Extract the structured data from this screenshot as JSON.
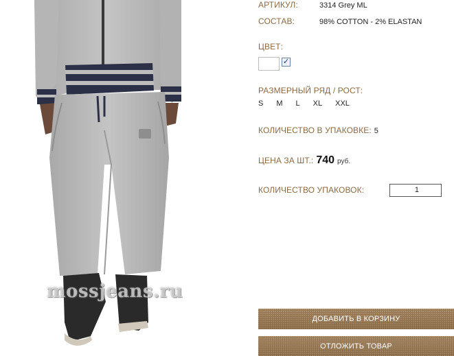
{
  "product_photo": {
    "watermark": "mossjeans.ru"
  },
  "details": {
    "article": {
      "label": "АРТИКУЛ:",
      "value": "3314 Grey ML"
    },
    "composition": {
      "label": "СОСТАВ:",
      "value": "98% COTTON - 2% ELASTAN"
    },
    "color": {
      "label": "ЦВЕТ:",
      "swatch_color": "#ffffff",
      "checked": true,
      "check_glyph": "✓"
    },
    "sizes": {
      "label": "РАЗМЕРНЫЙ РЯД / РОСТ:",
      "items": [
        "S",
        "M",
        "L",
        "XL",
        "XXL"
      ]
    },
    "pack_quantity": {
      "label": "КОЛИЧЕСТВО В УПАКОВКЕ:",
      "value": "5"
    },
    "price": {
      "label": "ЦЕНА ЗА ШТ.:",
      "value": "740",
      "currency": "руб."
    },
    "packs": {
      "label": "КОЛИЧЕСТВО УПАКОВОК:",
      "value": "1"
    }
  },
  "actions": {
    "add_to_cart": "ДОБАВИТЬ В КОРЗИНУ",
    "postpone": "ОТЛОЖИТЬ ТОВАР"
  },
  "colors": {
    "label_brown": "#8b6a43",
    "button_brown": "#8a6b48",
    "garment_grey": "#b9b9b9",
    "trim_navy": "#2b3046"
  }
}
